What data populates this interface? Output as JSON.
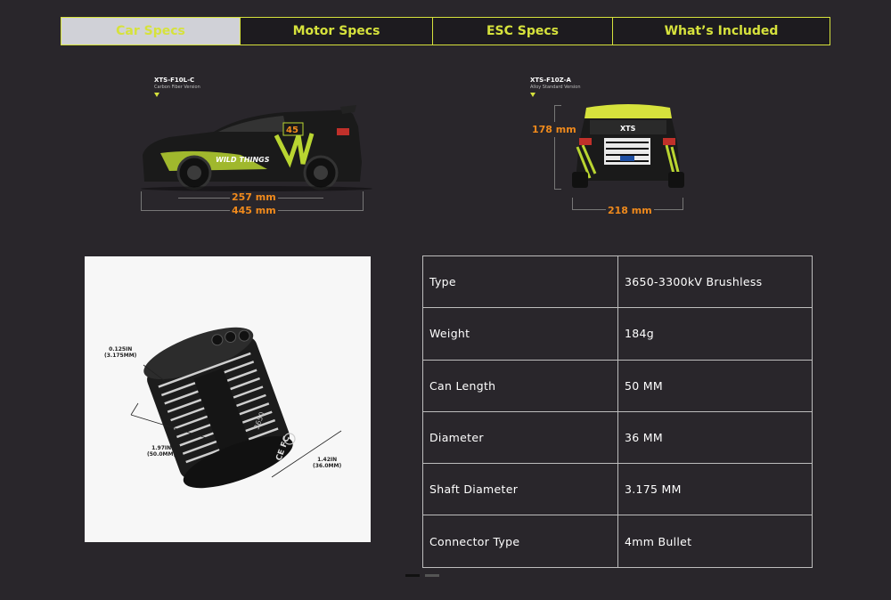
{
  "tabs": [
    {
      "label": "Car Specs",
      "active": true
    },
    {
      "label": "Motor Specs",
      "active": false
    },
    {
      "label": "ESC Specs",
      "active": false
    },
    {
      "label": "What’s Included",
      "active": false
    }
  ],
  "side_view": {
    "model": "XTS-F10L-C",
    "version": "Carbon Fiber Version",
    "wheelbase": "257 mm",
    "length": "445 mm",
    "car_number": "45",
    "livery_text": "WILD THINGS"
  },
  "rear_view": {
    "model": "XTS-F10Z-A",
    "version": "Alloy Standard Version",
    "height": "178 mm",
    "width": "218 mm",
    "roof_text": "XTS"
  },
  "motor_diagram": {
    "shaft_dim": "0.125IN\n(3.175MM)",
    "length_dim": "1.97IN\n(50.0MM)",
    "diameter_dim": "1.42IN\n(36.0MM)",
    "model_code": "3650",
    "cert_marks": "CE FC"
  },
  "specs": [
    {
      "key": "Type",
      "value": "3650-3300kV Brushless"
    },
    {
      "key": "Weight",
      "value": "184g"
    },
    {
      "key": "Can Length",
      "value": "50 MM"
    },
    {
      "key": "Diameter",
      "value": "36 MM"
    },
    {
      "key": "Shaft Diameter",
      "value": "3.175 MM"
    },
    {
      "key": "Connector Type",
      "value": "4mm Bullet"
    }
  ],
  "colors": {
    "accent": "#d6e23c",
    "dimension": "#f08a1c",
    "background": "#29262b"
  }
}
